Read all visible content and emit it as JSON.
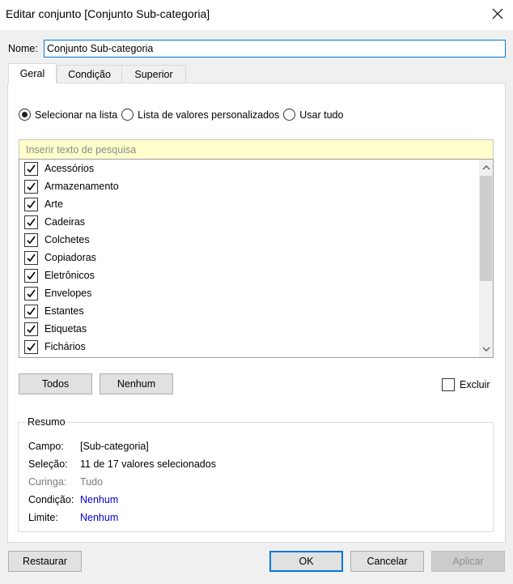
{
  "window": {
    "title": "Editar conjunto [Conjunto Sub-categoria]",
    "close_glyph": "✕"
  },
  "name_field": {
    "label": "Nome:",
    "value": "Conjunto Sub-categoria"
  },
  "tabs": [
    {
      "label": "Geral",
      "active": true
    },
    {
      "label": "Condição",
      "active": false
    },
    {
      "label": "Superior",
      "active": false
    }
  ],
  "mode_options": [
    {
      "label": "Selecionar na lista",
      "selected": true
    },
    {
      "label": "Lista de valores personalizados",
      "selected": false
    },
    {
      "label": "Usar tudo",
      "selected": false
    }
  ],
  "search": {
    "placeholder": "Inserir texto de pesquisa"
  },
  "list": {
    "items": [
      {
        "label": "Acessórios",
        "checked": true
      },
      {
        "label": "Armazenamento",
        "checked": true
      },
      {
        "label": "Arte",
        "checked": true
      },
      {
        "label": "Cadeiras",
        "checked": true
      },
      {
        "label": "Colchetes",
        "checked": true
      },
      {
        "label": "Copiadoras",
        "checked": true
      },
      {
        "label": "Eletrônicos",
        "checked": true
      },
      {
        "label": "Envelopes",
        "checked": true
      },
      {
        "label": "Estantes",
        "checked": true
      },
      {
        "label": "Etiquetas",
        "checked": true
      },
      {
        "label": "Fichários",
        "checked": true
      }
    ]
  },
  "list_buttons": {
    "all_label": "Todos",
    "none_label": "Nenhum"
  },
  "exclude": {
    "label": "Excluir",
    "checked": false
  },
  "summary": {
    "title": "Resumo",
    "rows": [
      {
        "key": "Campo:",
        "value": "[Sub-categoria]",
        "style": "normal"
      },
      {
        "key": "Seleção:",
        "value": "11 de 17 valores selecionados",
        "style": "normal"
      },
      {
        "key": "Curinga:",
        "value": "Tudo",
        "style": "dim"
      },
      {
        "key": "Condição:",
        "value": "Nenhum",
        "style": "link"
      },
      {
        "key": "Limite:",
        "value": "Nenhum",
        "style": "link"
      }
    ]
  },
  "footer": {
    "reset_label": "Restaurar",
    "ok_label": "OK",
    "cancel_label": "Cancelar",
    "apply_label": "Aplicar"
  },
  "colors": {
    "accent": "#0078d7",
    "search_bg": "#ffffcc",
    "link": "#0000cc"
  }
}
